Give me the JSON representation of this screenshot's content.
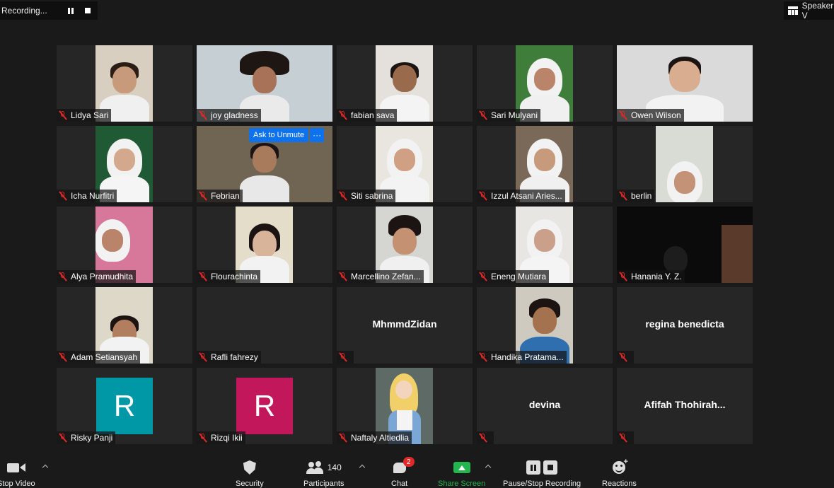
{
  "recording": {
    "label": "Recording..."
  },
  "view": {
    "label": "Speaker V"
  },
  "colors": {
    "avatar_teal": "#0097a7",
    "avatar_magenta": "#c2185b",
    "ask_unmute_blue": "#0e72ed",
    "mute_red": "#e02828",
    "share_green": "#23b64e"
  },
  "ask_unmute": {
    "label": "Ask to Unmute",
    "more": "···"
  },
  "participants": [
    {
      "name": "Lidya Sari"
    },
    {
      "name": "joy gladness"
    },
    {
      "name": "fabian sava"
    },
    {
      "name": "Sari Mulyani"
    },
    {
      "name": "Owen Wilson"
    },
    {
      "name": "Icha Nurfitri"
    },
    {
      "name": "Febrian"
    },
    {
      "name": "Siti sabrina"
    },
    {
      "name": "Izzul Atsani Aries..."
    },
    {
      "name": "berlin"
    },
    {
      "name": "Alya Pramudhita"
    },
    {
      "name": "Flourachinta"
    },
    {
      "name": "Marcellino Zefan..."
    },
    {
      "name": "Eneng Mutiara"
    },
    {
      "name": "Hanania Y. Z."
    },
    {
      "name": "Adam Setiansyah"
    },
    {
      "name": "Rafli fahrezy"
    },
    {
      "name": "MhmmdZidan"
    },
    {
      "name": "Handika Pratama..."
    },
    {
      "name": "regina benedicta"
    },
    {
      "name": "Risky Panji",
      "avatar": "R"
    },
    {
      "name": "Rizqi Ikii",
      "avatar": "R"
    },
    {
      "name": "Naftaly Altiedlia"
    },
    {
      "name": "devina"
    },
    {
      "name": "Afifah  Thohirah..."
    }
  ],
  "toolbar": {
    "stop_video": "Stop Video",
    "security": "Security",
    "participants": "Participants",
    "participants_count": "140",
    "chat": "Chat",
    "chat_badge": "2",
    "share_screen": "Share Screen",
    "recording": "Pause/Stop Recording",
    "reactions": "Reactions"
  }
}
